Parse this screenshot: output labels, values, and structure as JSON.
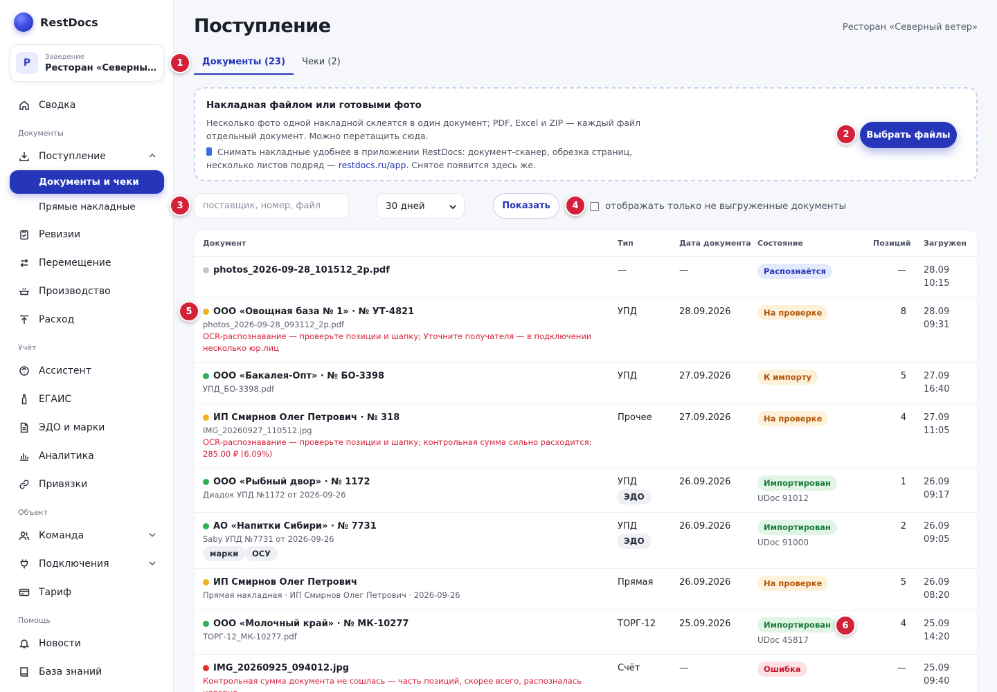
{
  "brand": {
    "name": "RestDocs"
  },
  "venue": {
    "caption": "Заведение",
    "avatar": "Р",
    "name": "Ресторан «Северный ветер»"
  },
  "nav": {
    "summary": "Сводка",
    "section_docs": "Документы",
    "incoming": "Поступление",
    "docs_and_checks": "Документы и чеки",
    "direct_invoices": "Прямые накладные",
    "revisions": "Ревизии",
    "movement": "Перемещение",
    "production": "Производство",
    "expense": "Расход",
    "section_account": "Учёт",
    "assistant": "Ассистент",
    "egais": "ЕГАИС",
    "edo": "ЭДО и марки",
    "analytics": "Аналитика",
    "bindings": "Привязки",
    "section_object": "Объект",
    "team": "Команда",
    "connections": "Подключения",
    "tariff": "Тариф",
    "section_help": "Помощь",
    "news": "Новости",
    "knowledge": "База знаний"
  },
  "page": {
    "title": "Поступление",
    "restaurant": "Ресторан «Северный ветер»"
  },
  "tabs": [
    {
      "label": "Документы (23)"
    },
    {
      "label": "Чеки (2)"
    }
  ],
  "upload": {
    "title": "Накладная файлом или готовыми фото",
    "line1": "Несколько фото одной накладной склеятся в один документ; PDF, Excel и ZIP — каждый файл отдельный документ. Можно перетащить сюда.",
    "line2_before": "Снимать накладные удобнее в приложении RestDocs: документ-сканер, обрезка страниц, несколько листов подряд — ",
    "line2_link": "restdocs.ru/app",
    "line2_after": ". Снятое появится здесь же.",
    "button": "Выбрать файлы"
  },
  "filters": {
    "search_placeholder": "поставщик, номер, файл",
    "search_value": "",
    "period": "30 дней",
    "show": "Показать",
    "only_not_exported": "отображать только не выгруженные документы"
  },
  "markers": [
    "1",
    "2",
    "3",
    "4",
    "5",
    "6"
  ],
  "table": {
    "headers": {
      "doc": "Документ",
      "type": "Тип",
      "date": "Дата документа",
      "state": "Состояние",
      "positions": "Позиций",
      "loaded": "Загружен"
    },
    "rows": [
      {
        "title": "photos_2026-09-28_101512_2p.pdf",
        "dot": "grey",
        "sub": "",
        "err": "",
        "type": "—",
        "date": "—",
        "state": "Распознаётся",
        "state_color": "blue",
        "udoc": "",
        "positions": "—",
        "loaded_date": "28.09",
        "loaded_time": "10:15"
      },
      {
        "title": "ООО «Овощная база № 1» · № УТ-4821",
        "dot": "yellow",
        "sub": "photos_2026-09-28_093112_2p.pdf",
        "err": "OCR-распознавание — проверьте позиции и шапку; Уточните получателя — в подключении несколько юр.лиц",
        "type": "УПД",
        "date": "28.09.2026",
        "state": "На проверке",
        "state_color": "orange",
        "udoc": "",
        "positions": "8",
        "loaded_date": "28.09",
        "loaded_time": "09:31"
      },
      {
        "title": "ООО «Бакалея-Опт» · № БО-3398",
        "dot": "green",
        "sub": "УПД_БО-3398.pdf",
        "err": "",
        "type": "УПД",
        "date": "27.09.2026",
        "state": "К импорту",
        "state_color": "orange",
        "udoc": "",
        "positions": "5",
        "loaded_date": "27.09",
        "loaded_time": "16:40"
      },
      {
        "title": "ИП Смирнов Олег Петрович · № 318",
        "dot": "yellow",
        "sub": "IMG_20260927_110512.jpg",
        "err": "OCR-распознавание — проверьте позиции и шапку; контрольная сумма сильно расходится: 285.00 ₽ (6.09%)",
        "type": "Прочее",
        "date": "27.09.2026",
        "state": "На проверке",
        "state_color": "orange",
        "udoc": "",
        "positions": "4",
        "loaded_date": "27.09",
        "loaded_time": "11:05"
      },
      {
        "title": "ООО «Рыбный двор» · № 1172",
        "dot": "green",
        "sub": "Диадок УПД №1172 от 2026-09-26",
        "err": "",
        "type": "УПД",
        "edo": "ЭДО",
        "date": "26.09.2026",
        "state": "Импортирован",
        "state_color": "green",
        "udoc": "UDoc 91012",
        "positions": "1",
        "loaded_date": "26.09",
        "loaded_time": "09:17"
      },
      {
        "title": "АО «Напитки Сибири» · № 7731",
        "dot": "green",
        "sub": "Saby УПД №7731 от 2026-09-26",
        "err": "",
        "tags": [
          "марки",
          "ОСУ"
        ],
        "type": "УПД",
        "edo": "ЭДО",
        "date": "26.09.2026",
        "state": "Импортирован",
        "state_color": "green",
        "udoc": "UDoc 91000",
        "positions": "2",
        "loaded_date": "26.09",
        "loaded_time": "09:05"
      },
      {
        "title": "ИП Смирнов Олег Петрович",
        "dot": "yellow",
        "sub": "Прямая накладная · ИП Смирнов Олег Петрович · 2026-09-26",
        "err": "",
        "type": "Прямая",
        "date": "26.09.2026",
        "state": "На проверке",
        "state_color": "orange",
        "udoc": "",
        "positions": "5",
        "loaded_date": "26.09",
        "loaded_time": "08:20"
      },
      {
        "title": "ООО «Молочный край» · № МК-10277",
        "dot": "green",
        "sub": "ТОРГ-12_МК-10277.pdf",
        "err": "",
        "type": "ТОРГ-12",
        "date": "25.09.2026",
        "state": "Импортирован",
        "state_color": "green",
        "udoc": "UDoc 45817",
        "positions": "4",
        "loaded_date": "25.09",
        "loaded_time": "14:20"
      },
      {
        "title": "IMG_20260925_094012.jpg",
        "dot": "red",
        "sub": "",
        "err": "Контрольная сумма документа не сошлась — часть позиций, скорее всего, распозналась неверно.",
        "type": "Счёт",
        "date": "—",
        "state": "Ошибка",
        "state_color": "red",
        "udoc": "",
        "positions": "—",
        "loaded_date": "25.09",
        "loaded_time": "09:40"
      }
    ]
  }
}
